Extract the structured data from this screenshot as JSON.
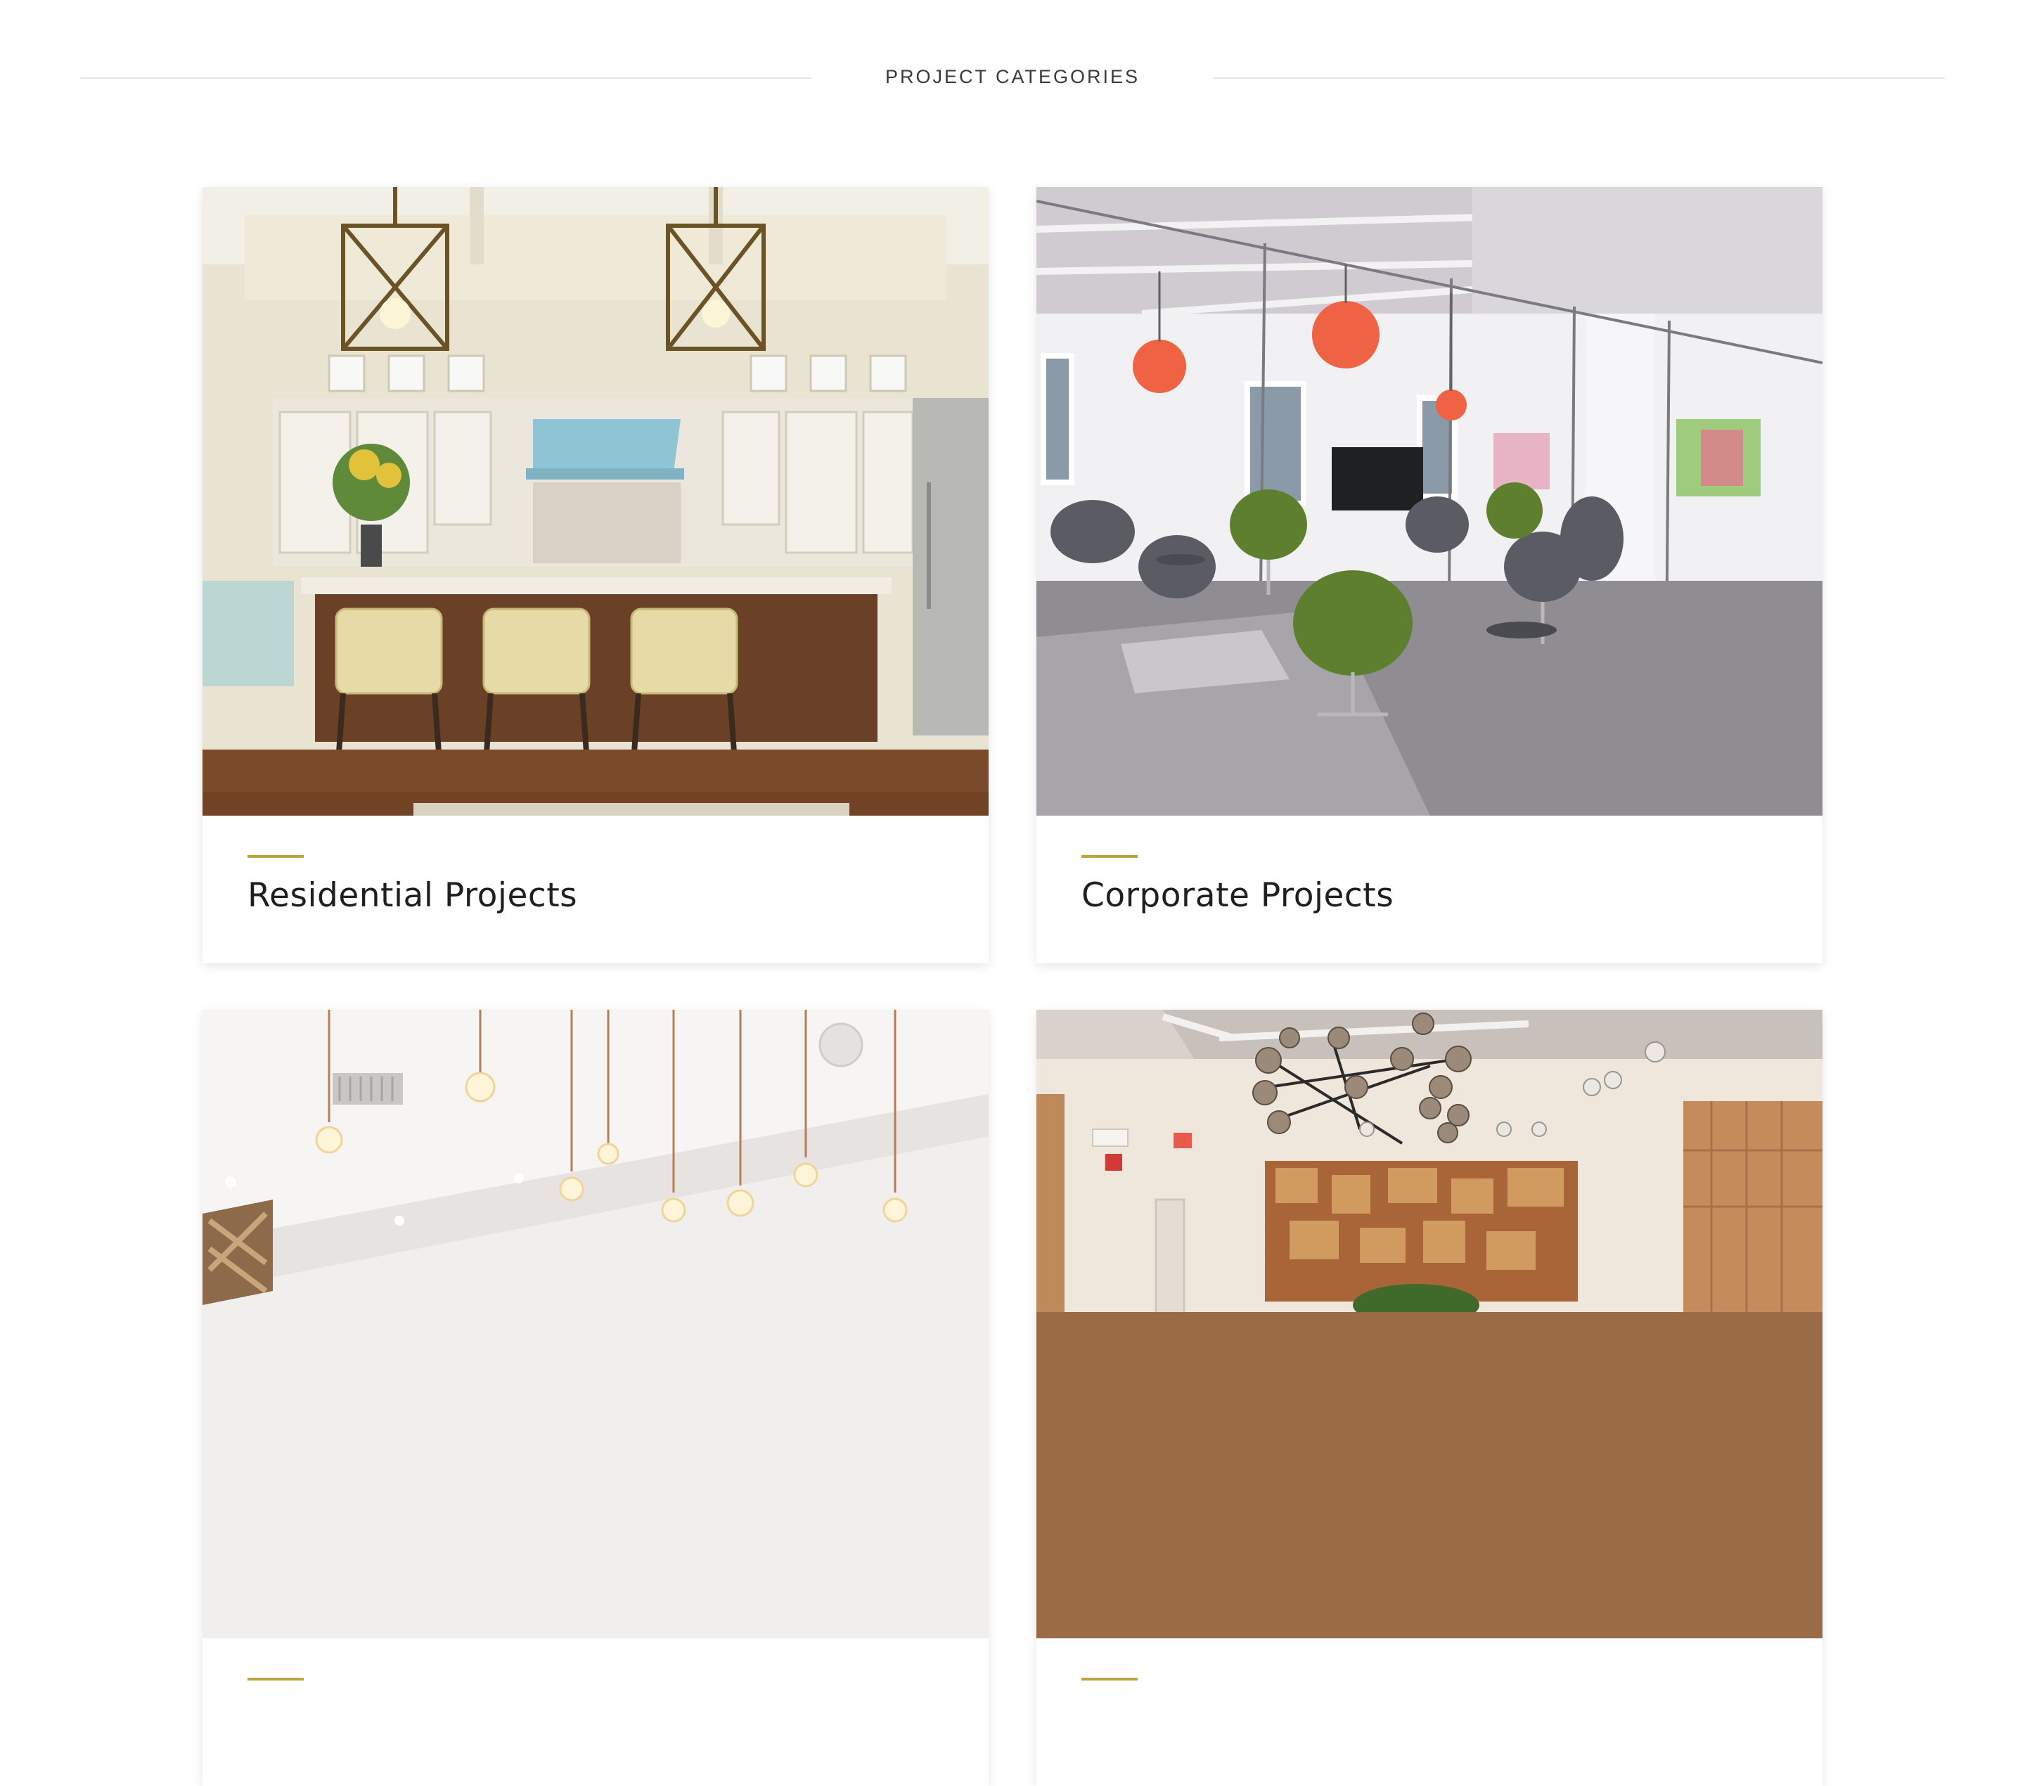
{
  "section": {
    "title": "PROJECT CATEGORIES"
  },
  "categories": [
    {
      "title": "Residential Projects",
      "image": "kitchen-interior-photo"
    },
    {
      "title": "Corporate Projects",
      "image": "office-lounge-photo"
    },
    {
      "title": "",
      "image": "restaurant-pendant-lights-photo"
    },
    {
      "title": "",
      "image": "lobby-chandelier-photo"
    }
  ],
  "colors": {
    "accent": "#b8a640",
    "text": "#1f1f1f",
    "rule": "#e3e3e3"
  }
}
